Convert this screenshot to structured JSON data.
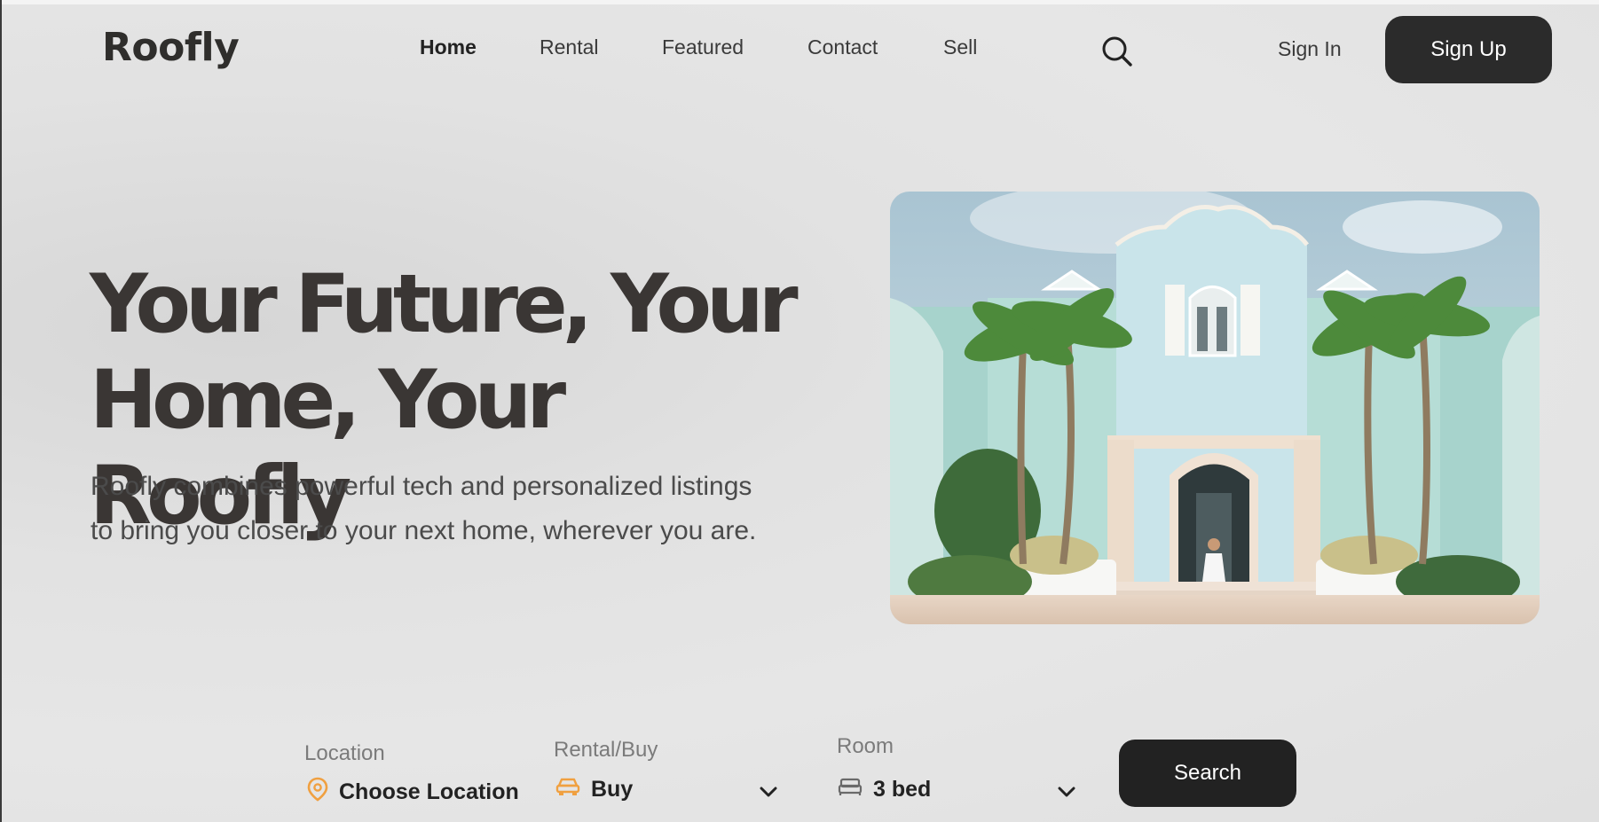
{
  "brand": {
    "logo_text": "Roofly"
  },
  "nav": {
    "items": [
      {
        "label": "Home",
        "active": true
      },
      {
        "label": "Rental",
        "active": false
      },
      {
        "label": "Featured",
        "active": false
      },
      {
        "label": "Contact",
        "active": false
      },
      {
        "label": "Sell",
        "active": false
      }
    ],
    "search_icon": "search-icon",
    "sign_in_label": "Sign In",
    "sign_up_label": "Sign Up"
  },
  "hero": {
    "headline_line1": "Your Future, Your",
    "headline_line2": "Home, Your Roofly",
    "subtext_line1": "Roofly combines powerful tech and personalized listings",
    "subtext_line2": "to bring you closer to your next home, wherever you are."
  },
  "search": {
    "location": {
      "label": "Location",
      "value": "Choose Location",
      "icon": "map-pin-icon"
    },
    "rental_buy": {
      "label": "Rental/Buy",
      "value": "Buy",
      "icon": "car-icon"
    },
    "room": {
      "label": "Room",
      "value": "3 bed",
      "icon": "bed-icon"
    },
    "button_label": "Search"
  },
  "colors": {
    "accent": "#f0a040",
    "dark_button": "#2b2b2b",
    "background": "#e4e4e4"
  }
}
